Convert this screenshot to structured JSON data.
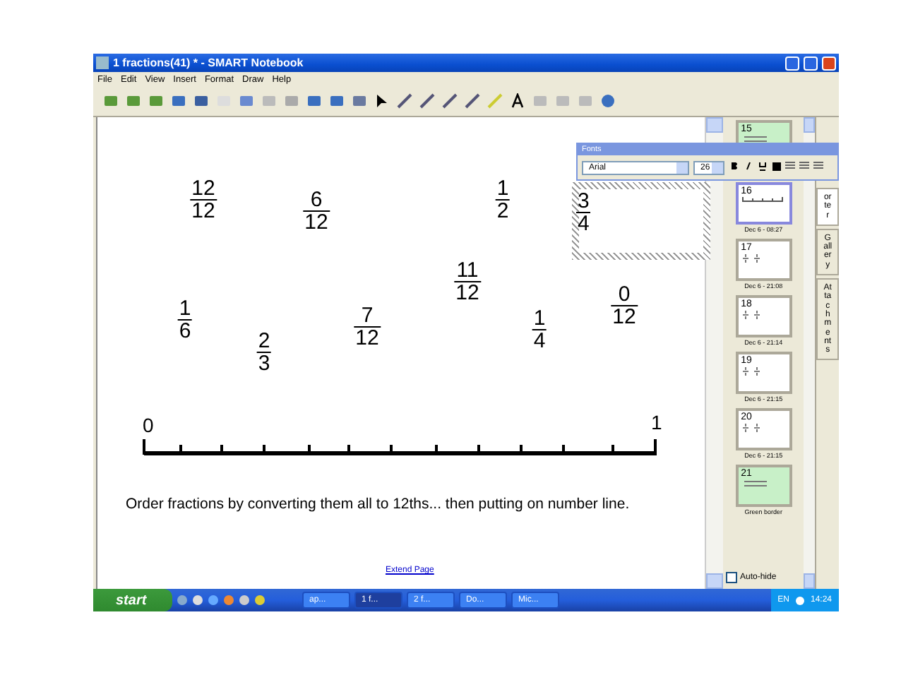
{
  "window": {
    "title": "1 fractions(41) * - SMART Notebook"
  },
  "menu": [
    "File",
    "Edit",
    "View",
    "Insert",
    "Format",
    "Draw",
    "Help"
  ],
  "canvas": {
    "fractions": [
      {
        "numerator": "12",
        "denominator": "12",
        "selected": false
      },
      {
        "numerator": "6",
        "denominator": "12",
        "selected": false
      },
      {
        "numerator": "1",
        "denominator": "2",
        "selected": false
      },
      {
        "numerator": "3",
        "denominator": "4",
        "selected": true
      },
      {
        "numerator": "11",
        "denominator": "12",
        "selected": false
      },
      {
        "numerator": "1",
        "denominator": "6",
        "selected": false
      },
      {
        "numerator": "7",
        "denominator": "12",
        "selected": false
      },
      {
        "numerator": "0",
        "denominator": "12",
        "selected": false
      },
      {
        "numerator": "1",
        "denominator": "4",
        "selected": false
      },
      {
        "numerator": "2",
        "denominator": "3",
        "selected": false
      }
    ],
    "number_line": {
      "start": "0",
      "end": "1"
    },
    "instruction": "Order fractions by converting them all to 12ths... then putting on number line.",
    "extend_link": "Extend Page"
  },
  "fonts_toolbar": {
    "title": "Fonts",
    "font": "Arial",
    "size": "26"
  },
  "sorter": {
    "pages": [
      {
        "number": "15",
        "kind": "green",
        "selected": false
      },
      {
        "number": "16",
        "kind": "numberline",
        "caption": "Dec 6 - 08:27",
        "selected": true
      },
      {
        "number": "17",
        "kind": "fractions",
        "caption": "Dec 6 - 21:08",
        "selected": false
      },
      {
        "number": "18",
        "kind": "fractions",
        "caption": "Dec 6 - 21:14",
        "selected": false
      },
      {
        "number": "19",
        "kind": "fractions",
        "caption": "Dec 6 - 21:15",
        "selected": false
      },
      {
        "number": "20",
        "kind": "fractions",
        "caption": "Dec 6 - 21:15",
        "selected": false
      },
      {
        "number": "21",
        "kind": "green",
        "caption": "Green border",
        "selected": false
      }
    ],
    "auto_hide": {
      "label": "Auto-hide",
      "checked": false
    },
    "tabs": [
      {
        "label": "orter",
        "selected": true
      },
      {
        "label": "Gallery",
        "selected": false
      },
      {
        "label": "Attachments",
        "selected": false
      }
    ]
  },
  "taskbar": {
    "start": "start",
    "tasks": [
      {
        "label": "ap...",
        "selected": false
      },
      {
        "label": "1 f...",
        "selected": true
      },
      {
        "label": "2 f...",
        "selected": false
      },
      {
        "label": "Do...",
        "selected": false
      },
      {
        "label": "Mic...",
        "selected": false
      }
    ],
    "language": "EN",
    "clock": "14:24"
  }
}
